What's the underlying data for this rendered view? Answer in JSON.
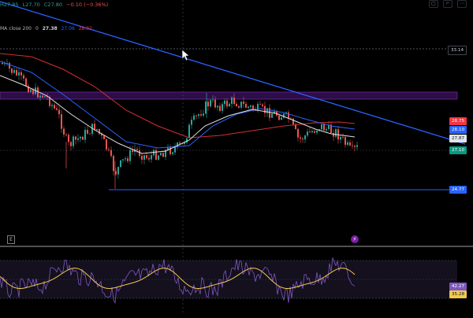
{
  "header": {
    "ohlc": {
      "h": "H27.85",
      "l": "L27.70",
      "c": "C27.80",
      "chg": "−0.10 (−0.36%)"
    },
    "ma_label": "MA close 200",
    "ma_zero": "0",
    "ma_values": [
      "27.38",
      "27.06",
      "28.02"
    ]
  },
  "price_tags": {
    "top_line": "33.14",
    "red": "28.75",
    "blue": "28.10",
    "white": "27.87",
    "green": "27.10",
    "support": "24.77"
  },
  "osc_tags": {
    "purple": "42.27",
    "yellow": "35.28"
  },
  "icons": {
    "top": [
      "square-icon",
      "bracket-icon",
      "dots-icon"
    ],
    "event": "E",
    "bolt": "⚡"
  },
  "colors": {
    "up": "#26a69a",
    "down": "#ef5350",
    "white_ma": "#e0e0e0",
    "blue_ma": "#2962ff",
    "red_ma": "#d32f2f",
    "trend": "#2962ff",
    "zone": "#4a148c",
    "osc_purple": "#7e57c2",
    "osc_yellow": "#f2c94c"
  },
  "chart_data": {
    "type": "candlestick",
    "price_range": [
      23.5,
      35
    ],
    "series": [
      {
        "name": "MA close 200",
        "values": []
      }
    ],
    "levels": {
      "resistance_dashed": 33.14,
      "support": 24.77,
      "zone": [
        30.2,
        30.7
      ]
    }
  }
}
